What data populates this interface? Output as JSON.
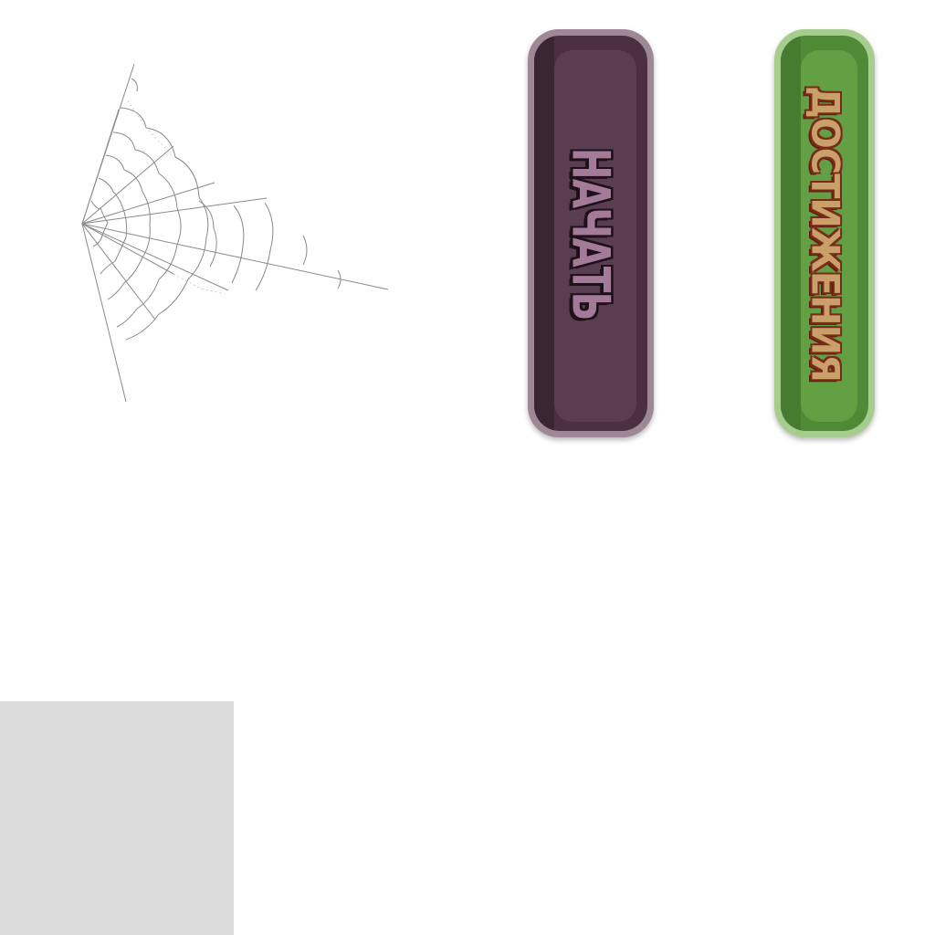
{
  "menu": {
    "start_label": "НАЧАТЬ",
    "achievements_label": "ДОСТИЖЕНИЯ"
  },
  "colors": {
    "start_button": "#593d50",
    "start_text": "#a37a98",
    "achievements_button": "#63a043",
    "achievements_text": "#c9a06a",
    "placeholder_panel": "#dbdbdb",
    "cobweb_line": "#8a8a8a"
  },
  "icons": {
    "decoration": "cobweb-icon"
  }
}
